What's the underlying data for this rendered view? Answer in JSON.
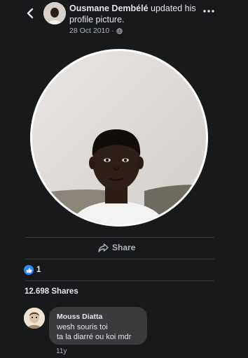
{
  "header": {
    "back_icon": "chevron-left-icon",
    "author": "Ousmane Dembélé",
    "action": " updated his profile picture.",
    "date": "28 Oct 2010",
    "separator": "·",
    "privacy_icon": "globe-icon",
    "more_icon": "more-dots-icon"
  },
  "post": {
    "photo_alt": "profile picture photo"
  },
  "actions": {
    "share_label": "Share",
    "share_icon": "share-arrow-icon"
  },
  "reactions": {
    "icon": "like-icon",
    "count": "1"
  },
  "shares": {
    "label": "12.698 Shares"
  },
  "comment": {
    "author": "Mouss Diatta",
    "text": "wesh souris  toi\nta la diarré ou koi mdr",
    "time": "11y"
  },
  "colors": {
    "background": "#18191a",
    "bubble": "#3a3b3c",
    "like_blue": "#2d88ff",
    "secondary_text": "#b0b3b8"
  }
}
